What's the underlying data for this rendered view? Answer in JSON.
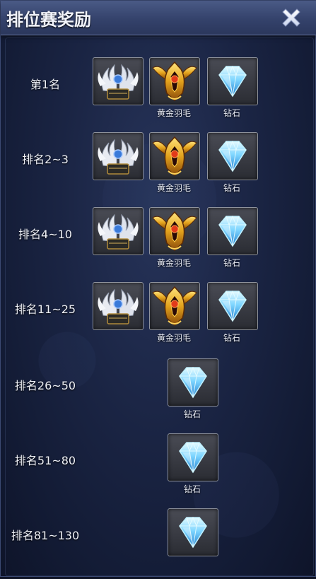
{
  "window": {
    "title": "排位赛奖励",
    "close_icon": "close-x-icon"
  },
  "items": {
    "wings": {
      "name": "",
      "icon": "silver-wings-icon"
    },
    "gold_feather": {
      "name": "黄金羽毛",
      "icon": "gold-feather-helmet-icon"
    },
    "diamond": {
      "name": "钻石",
      "icon": "diamond-icon"
    }
  },
  "rows": [
    {
      "rank": "第1名",
      "rewards": [
        "wings",
        "gold_feather",
        "diamond"
      ],
      "labels": [
        "",
        "黄金羽毛",
        "钻石"
      ]
    },
    {
      "rank": "排名2~3",
      "rewards": [
        "wings",
        "gold_feather",
        "diamond"
      ],
      "labels": [
        "",
        "黄金羽毛",
        "钻石"
      ]
    },
    {
      "rank": "排名4~10",
      "rewards": [
        "wings",
        "gold_feather",
        "diamond"
      ],
      "labels": [
        "",
        "黄金羽毛",
        "钻石"
      ]
    },
    {
      "rank": "排名11~25",
      "rewards": [
        "wings",
        "gold_feather",
        "diamond"
      ],
      "labels": [
        "",
        "黄金羽毛",
        "钻石"
      ]
    },
    {
      "rank": "排名26~50",
      "rewards": [
        "diamond"
      ],
      "labels": [
        "钻石"
      ]
    },
    {
      "rank": "排名51~80",
      "rewards": [
        "diamond"
      ],
      "labels": [
        "钻石"
      ]
    },
    {
      "rank": "排名81~130",
      "rewards": [
        "diamond"
      ],
      "labels": [
        ""
      ]
    }
  ],
  "colors": {
    "accent_title_bar": "#3a4872",
    "panel_bg": "#1a2443",
    "text": "#eef0f6"
  }
}
